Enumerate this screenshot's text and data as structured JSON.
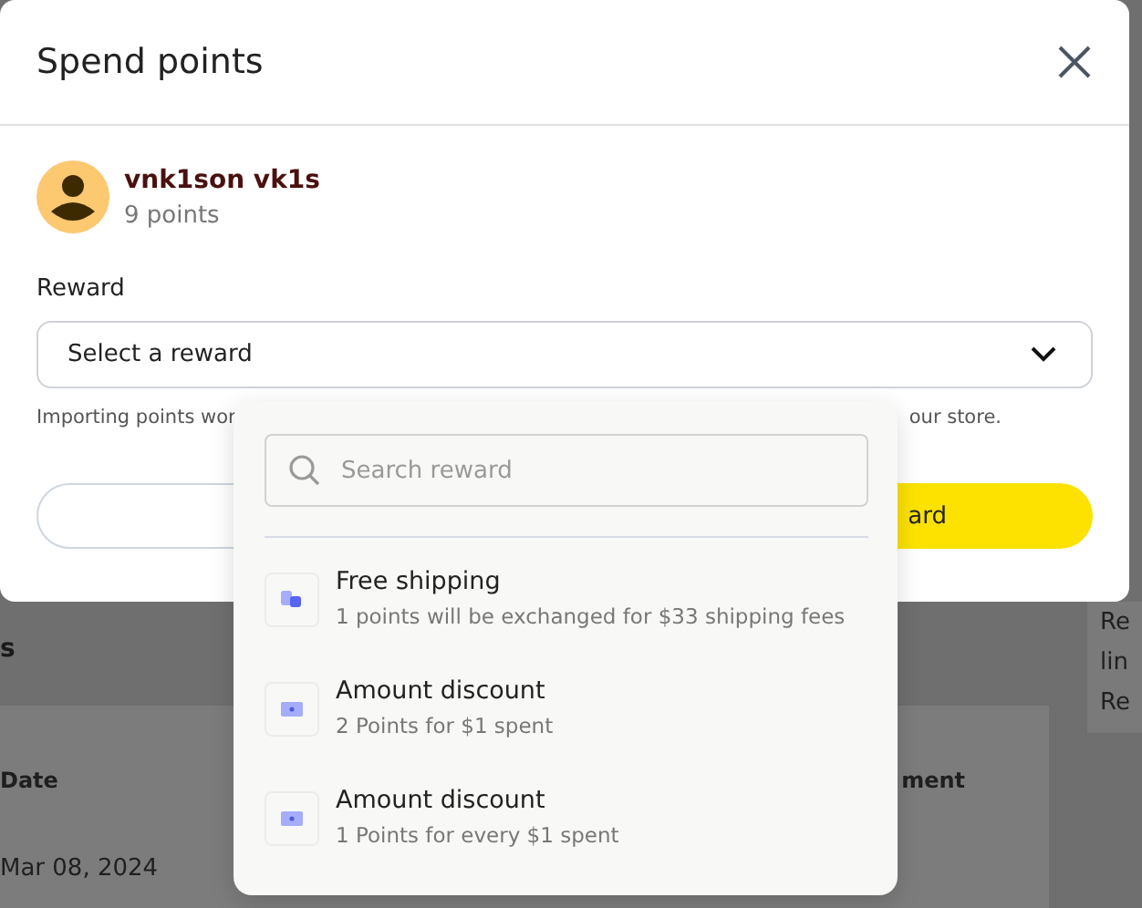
{
  "background": {
    "section_title": "s",
    "table_headers": [
      "Date",
      "ment"
    ],
    "table_cells": [
      "Mar 08, 2024"
    ],
    "side_texts": [
      "Re",
      "lin",
      "Re"
    ]
  },
  "dialog": {
    "title": "Spend points",
    "customer": {
      "name": "vnk1son vk1s",
      "points": "9 points"
    },
    "reward_label": "Reward",
    "select_value": "Select a reward",
    "helper_text_start": "Importing points wor",
    "helper_text_end": "our store.",
    "confirm_button": "ard"
  },
  "dropdown": {
    "search_placeholder": "Search reward",
    "options": [
      {
        "kind": "shipping",
        "title": "Free shipping",
        "description": "1 points will be exchanged for $33 shipping fees"
      },
      {
        "kind": "discount",
        "title": "Amount discount",
        "description": "2 Points for $1 spent"
      },
      {
        "kind": "discount",
        "title": "Amount discount",
        "description": "1 Points for every $1 spent"
      }
    ]
  }
}
